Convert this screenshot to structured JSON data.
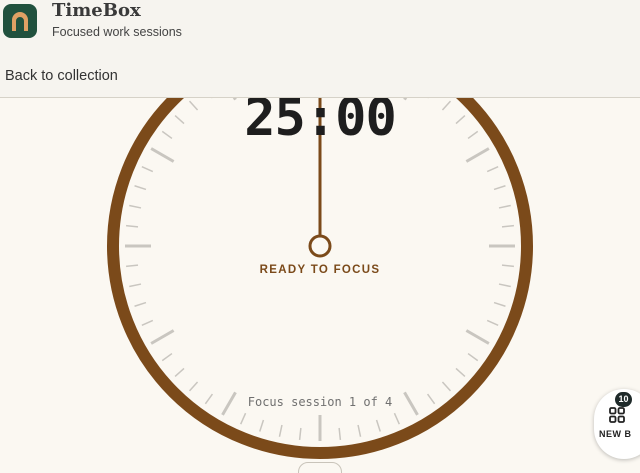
{
  "app": {
    "name": "TimeBox",
    "subtitle": "Focused work sessions",
    "icon": "arch-icon"
  },
  "nav": {
    "back_label": "Back to collection"
  },
  "timer": {
    "time": "25:00",
    "status": "READY TO FOCUS",
    "session": "Focus session 1 of 4"
  },
  "fab": {
    "label": "NEW B",
    "badge": "10",
    "icon": "grid-icon"
  },
  "colors": {
    "accent": "#7b4a1a",
    "dial_face": "#fbf8f2",
    "tick": "#c9c6c0",
    "app_icon_bg": "#21513e",
    "app_icon_fg": "#e0a064"
  }
}
